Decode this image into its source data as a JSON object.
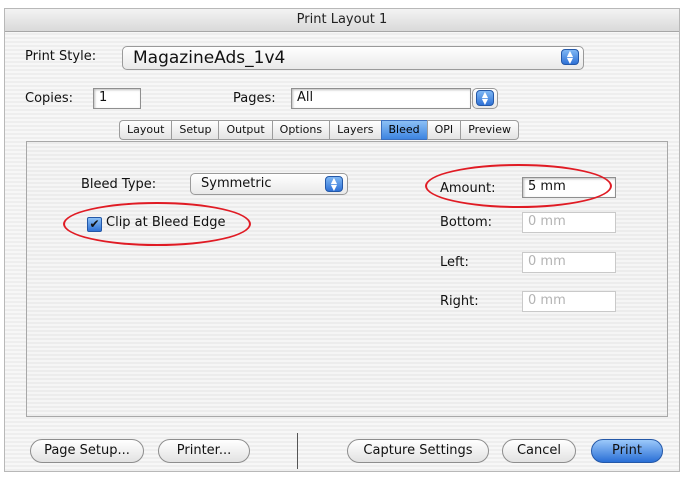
{
  "window": {
    "title": "Print Layout 1"
  },
  "print_style": {
    "label": "Print Style:",
    "value": "MagazineAds_1v4"
  },
  "copies": {
    "label": "Copies:",
    "value": "1"
  },
  "pages": {
    "label": "Pages:",
    "value": "All"
  },
  "tabs": [
    {
      "label": "Layout"
    },
    {
      "label": "Setup"
    },
    {
      "label": "Output"
    },
    {
      "label": "Options"
    },
    {
      "label": "Layers"
    },
    {
      "label": "Bleed",
      "active": true
    },
    {
      "label": "OPI"
    },
    {
      "label": "Preview"
    }
  ],
  "bleed": {
    "type_label": "Bleed Type:",
    "type_value": "Symmetric",
    "clip_label": "Clip at Bleed Edge",
    "clip_checked": true,
    "amount_label": "Amount:",
    "amount_value": "5 mm",
    "bottom_label": "Bottom:",
    "bottom_value": "0 mm",
    "left_label": "Left:",
    "left_value": "0 mm",
    "right_label": "Right:",
    "right_value": "0 mm"
  },
  "buttons": {
    "page_setup": "Page Setup...",
    "printer": "Printer...",
    "capture": "Capture Settings",
    "cancel": "Cancel",
    "print": "Print"
  },
  "colors": {
    "annotation": "#e01b24",
    "accent": "#2f72d6"
  }
}
